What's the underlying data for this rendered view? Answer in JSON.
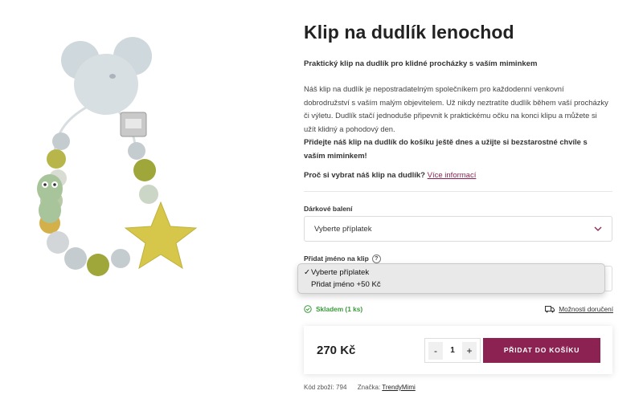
{
  "product": {
    "title": "Klip na dudlík lenochod",
    "subtitle": "Praktický klip na dudlík pro klidné procházky s vaším miminkem",
    "description": "Náš klip na dudlík je nepostradatelným společníkem pro každodenní venkovní dobrodružství s vaším malým objevitelem. Už nikdy neztratíte dudlík během vaší procházky či výletu. Dudlík stačí jednoduše připevnit k praktickému očku na konci klipu a můžete si užít klidný a pohodový den.",
    "description_bold": "Přidejte náš klip na dudlík do košíku ještě dnes a užijte si bezstarostné chvíle s vaším miminkem!",
    "why_text": "Proč si vybrat náš klip na dudlík?",
    "why_link": "Více informací"
  },
  "gift_wrap": {
    "label": "Dárkové balení",
    "value": "Vyberte příplatek"
  },
  "add_name": {
    "label": "Přidat jméno na klip",
    "help": "?",
    "options": [
      {
        "label": "Vyberte příplatek",
        "selected": true
      },
      {
        "label": "Přidat jméno +50 Kč",
        "selected": false
      }
    ]
  },
  "availability": {
    "stock": "Skladem (1 ks)",
    "delivery_link": "Možnosti doručení"
  },
  "buy": {
    "price": "270 Kč",
    "minus": "-",
    "quantity": "1",
    "plus": "+",
    "add_to_cart": "PŘIDAT DO KOŠÍKU"
  },
  "meta": {
    "code_label": "Kód zboží:",
    "code_value": "794",
    "brand_label": "Značka:",
    "brand_value": "TrendyMimi"
  },
  "colors": {
    "accent": "#8b2252",
    "stock_green": "#3a9a3a"
  },
  "icons": [
    "check-circle-icon",
    "truck-icon",
    "chevron-down-icon",
    "checkmark-icon"
  ]
}
